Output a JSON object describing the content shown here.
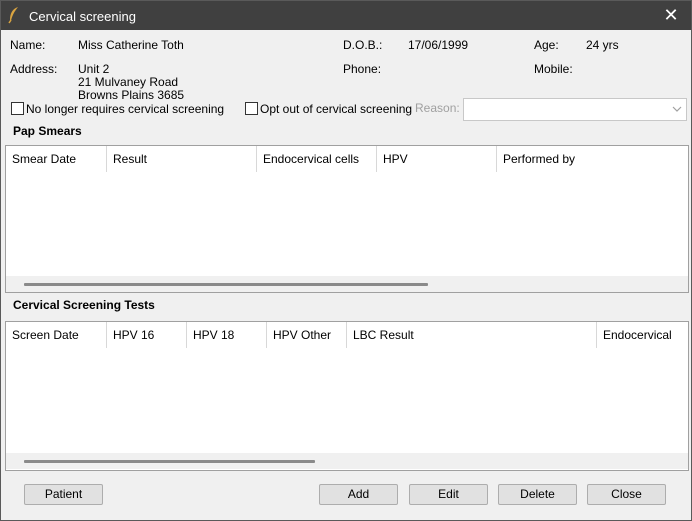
{
  "window": {
    "title": "Cervical screening",
    "close_glyph": "✕"
  },
  "patient": {
    "name_label": "Name:",
    "name_value": "Miss Catherine Toth",
    "dob_label": "D.O.B.:",
    "dob_value": "17/06/1999",
    "age_label": "Age:",
    "age_value": "24 yrs",
    "address_label": "Address:",
    "address_line1": "Unit 2",
    "address_line2": "21 Mulvaney Road",
    "address_line3": "Browns Plains  3685",
    "phone_label": "Phone:",
    "mobile_label": "Mobile:"
  },
  "options": {
    "no_longer_requires": "No longer requires cervical screening",
    "opt_out": "Opt out of cervical screening",
    "reason_label": "Reason:",
    "reason_value": ""
  },
  "pap_smears": {
    "title": "Pap Smears",
    "columns": [
      "Smear Date",
      "Result",
      "Endocervical cells",
      "HPV",
      "Performed by"
    ],
    "rows": []
  },
  "screening_tests": {
    "title": "Cervical Screening Tests",
    "columns": [
      "Screen Date",
      "HPV 16",
      "HPV 18",
      "HPV Other",
      "LBC Result",
      "Endocervical cells"
    ],
    "rows": []
  },
  "buttons": {
    "patient": "Patient",
    "add": "Add",
    "edit": "Edit",
    "delete": "Delete",
    "close": "Close"
  },
  "icons": {
    "app": "feather-icon",
    "close": "close-icon",
    "dropdown": "chevron-down-icon"
  }
}
